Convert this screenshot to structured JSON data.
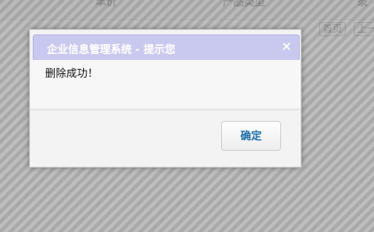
{
  "table": {
    "headers": {
      "price": "单价",
      "product_type": "产品类型",
      "partial": "录"
    }
  },
  "pager": {
    "first": "首页",
    "prev": "上一"
  },
  "dialog": {
    "title": "企业信息管理系统 - 提示您",
    "close_symbol": "×",
    "message": "删除成功！",
    "confirm_label": "确定"
  },
  "colors": {
    "titlebar": "#c9c8ee",
    "confirm_text": "#1e6fa8"
  }
}
